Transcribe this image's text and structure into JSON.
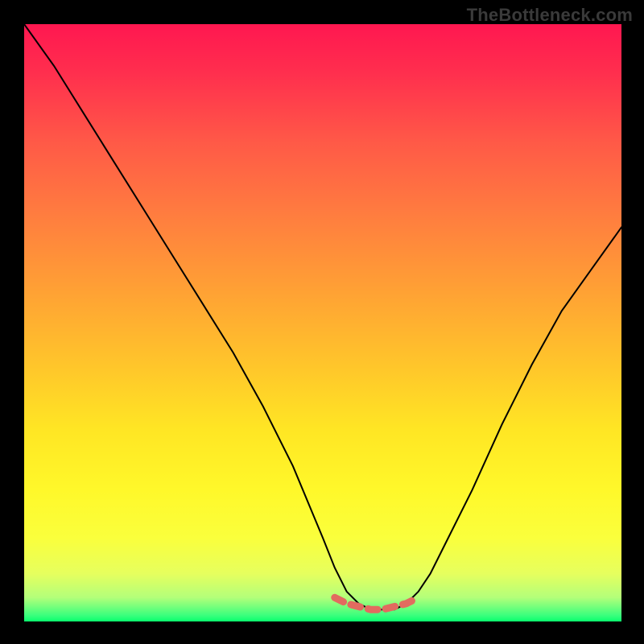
{
  "watermark": "TheBottleneck.com",
  "colors": {
    "frame": "#000000",
    "curve": "#000000",
    "highlight": "#e26b5f"
  },
  "chart_data": {
    "type": "line",
    "title": "",
    "xlabel": "",
    "ylabel": "",
    "xlim": [
      0,
      100
    ],
    "ylim": [
      0,
      100
    ],
    "grid": false,
    "legend": false,
    "series": [
      {
        "name": "bottleneck_curve",
        "x": [
          0,
          5,
          10,
          15,
          20,
          25,
          30,
          35,
          40,
          45,
          50,
          52,
          54,
          56,
          58,
          60,
          62,
          64,
          66,
          68,
          70,
          75,
          80,
          85,
          90,
          95,
          100
        ],
        "y": [
          100,
          93,
          85,
          77,
          69,
          61,
          53,
          45,
          36,
          26,
          14,
          9,
          5,
          3,
          2,
          2,
          2,
          3,
          5,
          8,
          12,
          22,
          33,
          43,
          52,
          59,
          66
        ]
      }
    ],
    "highlight_segment": {
      "x": [
        52,
        54,
        56,
        58,
        60,
        62,
        64,
        66
      ],
      "y": [
        4,
        3,
        2.5,
        2,
        2,
        2.5,
        3,
        4
      ]
    },
    "background_gradient": {
      "direction": "top_to_bottom",
      "stops": [
        {
          "pos": 0.0,
          "color": "#ff1750"
        },
        {
          "pos": 0.2,
          "color": "#ff5a47"
        },
        {
          "pos": 0.45,
          "color": "#ffa234"
        },
        {
          "pos": 0.68,
          "color": "#ffe624"
        },
        {
          "pos": 0.86,
          "color": "#faff3c"
        },
        {
          "pos": 0.96,
          "color": "#b3ff7a"
        },
        {
          "pos": 1.0,
          "color": "#08ff6d"
        }
      ]
    }
  }
}
